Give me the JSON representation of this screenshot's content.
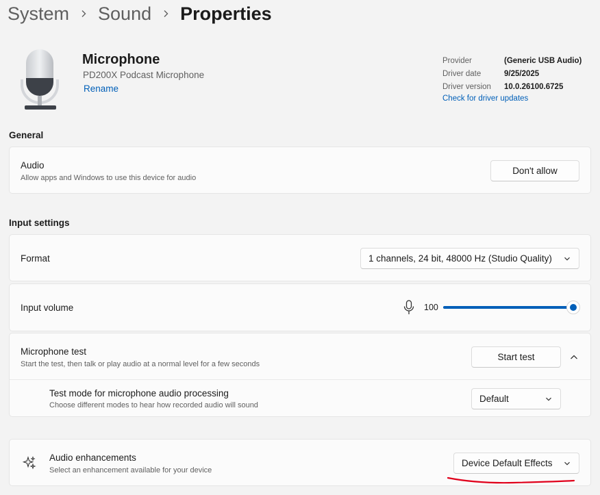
{
  "breadcrumb": {
    "item1": "System",
    "item2": "Sound",
    "current": "Properties"
  },
  "device": {
    "name": "Microphone",
    "model": "PD200X Podcast Microphone",
    "rename_label": "Rename"
  },
  "driver": {
    "provider_label": "Provider",
    "provider_value": "(Generic USB Audio)",
    "date_label": "Driver date",
    "date_value": "9/25/2025",
    "version_label": "Driver version",
    "version_value": "10.0.26100.6725",
    "update_link": "Check for driver updates"
  },
  "general": {
    "title": "General",
    "audio_title": "Audio",
    "audio_sub": "Allow apps and Windows to use this device for audio",
    "audio_button": "Don't allow"
  },
  "input": {
    "title": "Input settings",
    "format_label": "Format",
    "format_value": "1 channels, 24 bit, 48000 Hz (Studio Quality)",
    "volume_label": "Input volume",
    "volume_value": "100",
    "mic_test_title": "Microphone test",
    "mic_test_sub": "Start the test, then talk or play audio at a normal level for a few seconds",
    "start_test": "Start test",
    "test_mode_title": "Test mode for microphone audio processing",
    "test_mode_sub": "Choose different modes to hear how recorded audio will sound",
    "test_mode_value": "Default"
  },
  "enhancements": {
    "title": "Audio enhancements",
    "sub": "Select an enhancement available for your device",
    "value": "Device Default Effects"
  },
  "icons": {
    "mic_device": "microphone-illustration-icon",
    "mic": "microphone-icon",
    "sparkle": "sparkle-icon",
    "chevron_right": "chevron-right-icon",
    "chevron_down": "chevron-down-icon",
    "chevron_up": "chevron-up-icon"
  },
  "colors": {
    "accent": "#005fb8",
    "annotation": "#e0001b"
  }
}
